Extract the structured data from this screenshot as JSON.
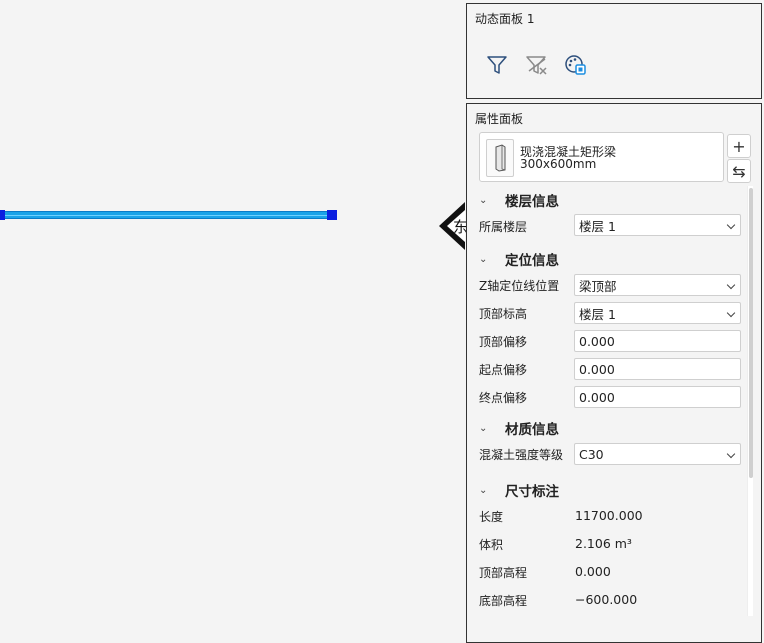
{
  "canvas": {
    "view_cube_label": "东"
  },
  "dynamic_panel": {
    "title": "动态面板 1",
    "tools": [
      "filter-icon",
      "clear-filter-icon",
      "palette-icon"
    ]
  },
  "property_panel": {
    "title": "属性面板",
    "type_card": {
      "name": "现浇混凝土矩形梁",
      "size": "300x600mm"
    },
    "add_label": "+",
    "settings_label": "⇆",
    "sections": {
      "floor": {
        "title": "楼层信息",
        "floor_label": "所属楼层",
        "floor_value": "楼层 1"
      },
      "position": {
        "title": "定位信息",
        "z_axis_label": "Z轴定位线位置",
        "z_axis_value": "梁顶部",
        "top_elev_label": "顶部标高",
        "top_elev_value": "楼层 1",
        "top_offset_label": "顶部偏移",
        "top_offset_value": "0.000",
        "start_offset_label": "起点偏移",
        "start_offset_value": "0.000",
        "end_offset_label": "终点偏移",
        "end_offset_value": "0.000"
      },
      "material": {
        "title": "材质信息",
        "grade_label": "混凝土强度等级",
        "grade_value": "C30"
      },
      "dimension": {
        "title": "尺寸标注",
        "length_label": "长度",
        "length_value": "11700.000",
        "volume_label": "体积",
        "volume_value": "2.106 m³",
        "top_height_label": "顶部高程",
        "top_height_value": "0.000",
        "bottom_height_label": "底部高程",
        "bottom_height_value": "−600.000"
      }
    }
  },
  "colors": {
    "beam": "#1ba3e8",
    "grip": "#0b1fe0",
    "panel_border": "#333333"
  }
}
